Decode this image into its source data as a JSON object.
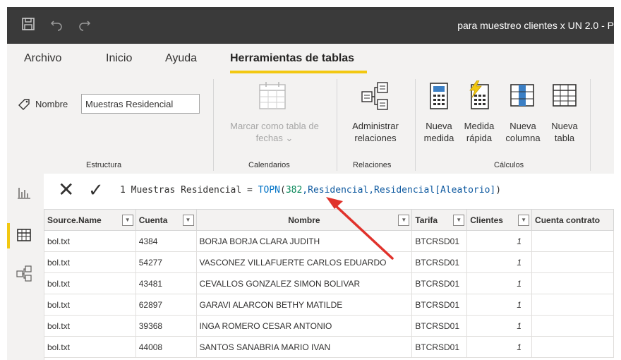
{
  "window": {
    "title": "para muestreo clientes x UN 2.0 - P"
  },
  "quick_access": [
    "save-icon",
    "undo-icon",
    "redo-icon"
  ],
  "tabs": [
    "Archivo",
    "Inicio",
    "Ayuda",
    "Herramientas de tablas"
  ],
  "active_tab": "Herramientas de tablas",
  "ribbon": {
    "estructura": {
      "name_label": "Nombre",
      "name_value": "Muestras Residencial",
      "group": "Estructura"
    },
    "calendarios": {
      "mark_label_1": "Marcar como tabla de",
      "mark_label_2": "fechas ⌄",
      "group": "Calendarios"
    },
    "relaciones": {
      "admin_label_1": "Administrar",
      "admin_label_2": "relaciones",
      "group": "Relaciones"
    },
    "calculos": {
      "nueva_medida_1": "Nueva",
      "nueva_medida_2": "medida",
      "medida_rapida_1": "Medida",
      "medida_rapida_2": "rápida",
      "nueva_columna_1": "Nueva",
      "nueva_columna_2": "columna",
      "nueva_tabla_1": "Nueva",
      "nueva_tabla_2": "tabla",
      "group": "Cálculos"
    }
  },
  "formula": {
    "cancel": "✕",
    "commit": "✓",
    "line": "1",
    "prefix": " Muestras Residencial = ",
    "fn": "TOPN",
    "open": "(",
    "num": "382",
    "rest1": ",Residencial,",
    "ref": "Residencial[Aleatorio]",
    "close": ")"
  },
  "table": {
    "columns": [
      "Source.Name",
      "Cuenta",
      "Nombre",
      "Tarifa",
      "Clientes",
      "Cuenta contrato"
    ],
    "rows": [
      [
        "bol.txt",
        "4384",
        "BORJA BORJA CLARA JUDITH",
        "BTCRSD01",
        "1",
        ""
      ],
      [
        "bol.txt",
        "54277",
        "VASCONEZ VILLAFUERTE CARLOS EDUARDO",
        "BTCRSD01",
        "1",
        ""
      ],
      [
        "bol.txt",
        "43481",
        "CEVALLOS GONZALEZ SIMON BOLIVAR",
        "BTCRSD01",
        "1",
        ""
      ],
      [
        "bol.txt",
        "62897",
        "GARAVI ALARCON BETHY MATILDE",
        "BTCRSD01",
        "1",
        ""
      ],
      [
        "bol.txt",
        "39368",
        "INGA ROMERO CESAR ANTONIO",
        "BTCRSD01",
        "1",
        ""
      ],
      [
        "bol.txt",
        "44008",
        "SANTOS SANABRIA MARIO IVAN",
        "BTCRSD01",
        "1",
        ""
      ]
    ]
  },
  "colors": {
    "accent": "#f2c811",
    "titlebar": "#3a3a3a",
    "annotation_arrow": "#e0322b"
  }
}
